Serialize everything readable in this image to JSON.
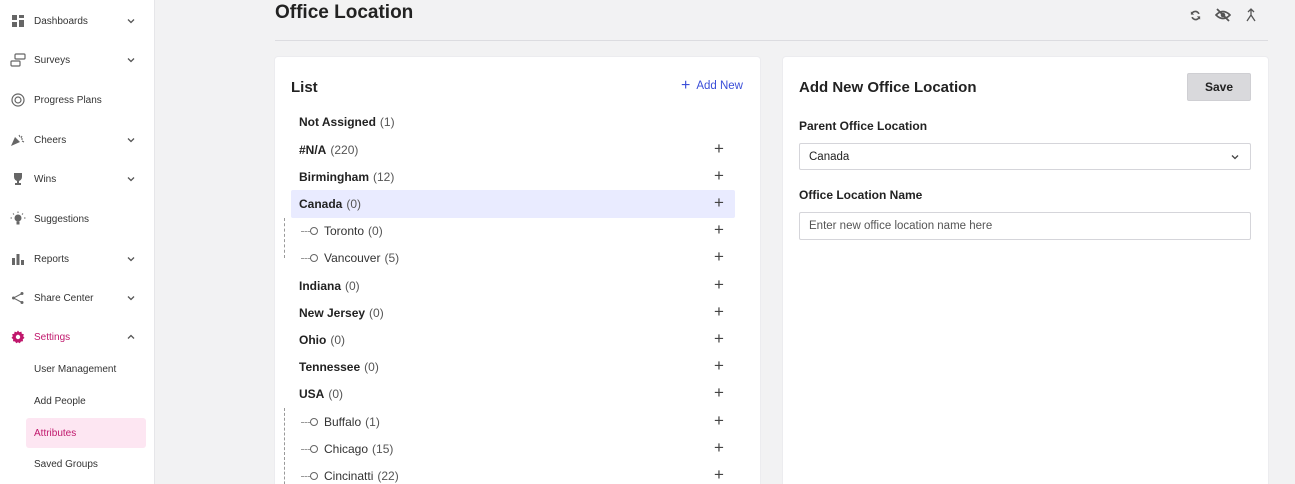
{
  "sidebar": {
    "items": [
      {
        "label": "Dashboards",
        "icon": "dashboard-icon",
        "chevron": "down"
      },
      {
        "label": "Surveys",
        "icon": "survey-icon",
        "chevron": "down"
      },
      {
        "label": "Progress Plans",
        "icon": "target-icon",
        "chevron": ""
      },
      {
        "label": "Cheers",
        "icon": "party-popper-icon",
        "chevron": "down"
      },
      {
        "label": "Wins",
        "icon": "trophy-icon",
        "chevron": "down"
      },
      {
        "label": "Suggestions",
        "icon": "lightbulb-icon",
        "chevron": ""
      },
      {
        "label": "Reports",
        "icon": "bar-chart-icon",
        "chevron": "down"
      },
      {
        "label": "Share Center",
        "icon": "share-icon",
        "chevron": "down"
      },
      {
        "label": "Settings",
        "icon": "gear-icon",
        "chevron": "up"
      }
    ],
    "settings_sub": [
      {
        "label": "User Management"
      },
      {
        "label": "Add People"
      },
      {
        "label": "Attributes"
      },
      {
        "label": "Saved Groups"
      }
    ],
    "accent_color": "#c0176c"
  },
  "header": {
    "title": "Office Location",
    "icons": [
      "refresh-icon",
      "eye-off-icon",
      "collapse-icon"
    ]
  },
  "list": {
    "title": "List",
    "add_new_label": "Add New",
    "rows": [
      {
        "name": "Not Assigned",
        "count": "(1)",
        "level": 0
      },
      {
        "name": "#N/A",
        "count": "(220)",
        "level": 0
      },
      {
        "name": "Birmingham",
        "count": "(12)",
        "level": 0
      },
      {
        "name": "Canada",
        "count": "(0)",
        "level": 0,
        "selected": true
      },
      {
        "name": "Toronto",
        "count": "(0)",
        "level": 1
      },
      {
        "name": "Vancouver",
        "count": "(5)",
        "level": 1
      },
      {
        "name": "Indiana",
        "count": "(0)",
        "level": 0
      },
      {
        "name": "New Jersey",
        "count": "(0)",
        "level": 0
      },
      {
        "name": "Ohio",
        "count": "(0)",
        "level": 0
      },
      {
        "name": "Tennessee",
        "count": "(0)",
        "level": 0
      },
      {
        "name": "USA",
        "count": "(0)",
        "level": 0
      },
      {
        "name": "Buffalo",
        "count": "(1)",
        "level": 1
      },
      {
        "name": "Chicago",
        "count": "(15)",
        "level": 1
      },
      {
        "name": "Cincinatti",
        "count": "(22)",
        "level": 1
      }
    ]
  },
  "form": {
    "title": "Add New Office Location",
    "save_label": "Save",
    "parent_label": "Parent Office Location",
    "parent_value": "Canada",
    "name_label": "Office Location Name",
    "name_placeholder": "Enter new office location name here"
  }
}
